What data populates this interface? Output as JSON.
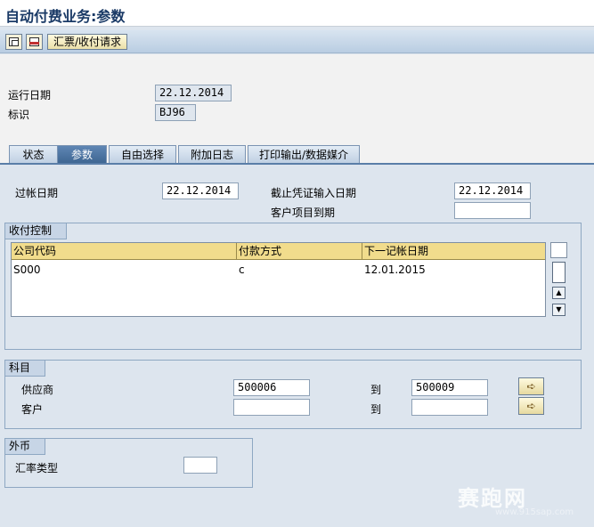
{
  "window": {
    "title": "自动付费业务:参数"
  },
  "toolbar": {
    "remittance_button": "汇票/收付请求"
  },
  "header": {
    "run_date_label": "运行日期",
    "run_date": "22.12.2014",
    "identifier_label": "标识",
    "identifier": "BJ96"
  },
  "tabs": [
    {
      "label": "状态"
    },
    {
      "label": "参数"
    },
    {
      "label": "自由选择"
    },
    {
      "label": "附加日志"
    },
    {
      "label": "打印输出/数据媒介"
    }
  ],
  "params": {
    "posting_date_label": "过帐日期",
    "posting_date": "22.12.2014",
    "doc_entry_label": "截止凭证输入日期",
    "doc_entry_date": "22.12.2014",
    "customer_due_label": "客户项目到期",
    "customer_due": ""
  },
  "payment_control": {
    "title": "收付控制",
    "columns": [
      "公司代码",
      "付款方式",
      "下一记帐日期"
    ],
    "rows": [
      [
        "S000",
        "c",
        "12.01.2015"
      ]
    ]
  },
  "accounts": {
    "title": "科目",
    "vendor_label": "供应商",
    "vendor_from": "500006",
    "vendor_to_label": "到",
    "vendor_to": "500009",
    "customer_label": "客户",
    "customer_from": "",
    "customer_to_label": "到",
    "customer_to": ""
  },
  "foreign_currency": {
    "title": "外币",
    "rate_type_label": "汇率类型",
    "rate_type": ""
  },
  "watermark": {
    "main": "赛跑网",
    "url": "www.915sap.com"
  }
}
